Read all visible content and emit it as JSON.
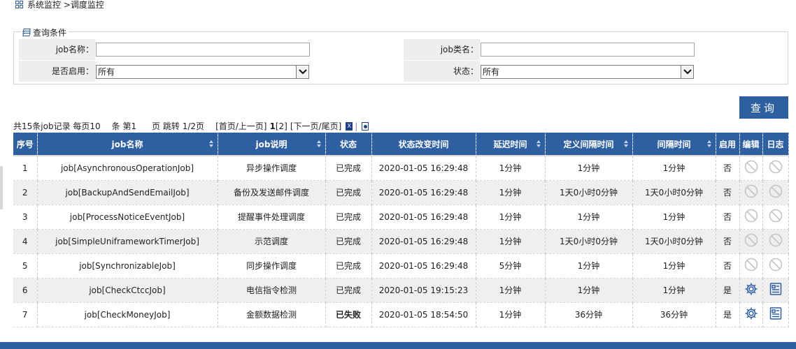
{
  "breadcrumb": {
    "text": "系统监控 >调度监控"
  },
  "query": {
    "legend": "查询条件",
    "job_name_label": "job名称：",
    "job_name_value": "",
    "job_class_label": "job类名：",
    "job_class_value": "",
    "enabled_label": "是否启用：",
    "enabled_selected": "所有",
    "status_label": "状态：",
    "status_selected": "所有",
    "search_button": "查询"
  },
  "pager": {
    "summary": "共15条job记录  每页10",
    "per_page_unit": "条 第1",
    "page_jump": "页 跳转 1/2页",
    "first_prev": "[首页/上一页]",
    "current_page": "1",
    "other_page": "[2]",
    "next_last": "[下一页/尾页]"
  },
  "table": {
    "headers": [
      "序号",
      "job名称",
      "job说明",
      "状态",
      "状态改变时间",
      "延迟时间",
      "定义间隔时间",
      "间隔时间",
      "启用",
      "编辑",
      "日志"
    ],
    "rows": [
      {
        "no": "1",
        "name": "job[AsynchronousOperationJob]",
        "desc": "异步操作调度",
        "status": "已完成",
        "time": "2020-01-05 16:29:48",
        "delay": "1分钟",
        "def_interval": "1分钟",
        "interval": "1分钟",
        "enabled": "否"
      },
      {
        "no": "2",
        "name": "job[BackupAndSendEmailJob]",
        "desc": "备份及发送邮件调度",
        "status": "已完成",
        "time": "2020-01-05 16:29:48",
        "delay": "1分钟",
        "def_interval": "1天0小时0分钟",
        "interval": "1天0小时0分钟",
        "enabled": "否"
      },
      {
        "no": "3",
        "name": "job[ProcessNoticeEventJob]",
        "desc": "提醒事件处理调度",
        "status": "已完成",
        "time": "2020-01-05 16:29:48",
        "delay": "1分钟",
        "def_interval": "1分钟",
        "interval": "1分钟",
        "enabled": "否"
      },
      {
        "no": "4",
        "name": "job[SimpleUniframeworkTimerJob]",
        "desc": "示范调度",
        "status": "已完成",
        "time": "2020-01-05 16:29:48",
        "delay": "1分钟",
        "def_interval": "1天0小时0分钟",
        "interval": "1天0小时0分钟",
        "enabled": "否"
      },
      {
        "no": "5",
        "name": "job[SynchronizableJob]",
        "desc": "同步操作调度",
        "status": "已完成",
        "time": "2020-01-05 16:29:48",
        "delay": "5分钟",
        "def_interval": "1分钟",
        "interval": "1分钟",
        "enabled": "否"
      },
      {
        "no": "6",
        "name": "job[CheckCtccJob]",
        "desc": "电信指令检测",
        "status": "已完成",
        "time": "2020-01-05 19:15:23",
        "delay": "1分钟",
        "def_interval": "1分钟",
        "interval": "1分钟",
        "enabled": "是"
      },
      {
        "no": "7",
        "name": "job[CheckMoneyJob]",
        "desc": "金额数据检测",
        "status": "已失败",
        "time": "2020-01-05 18:54:50",
        "delay": "1分钟",
        "def_interval": "36分钟",
        "interval": "36分钟",
        "enabled": "是"
      }
    ]
  },
  "colors": {
    "header_bg": "#2e5fa0",
    "fail": "#d40000",
    "alt_row": "#efefef"
  }
}
